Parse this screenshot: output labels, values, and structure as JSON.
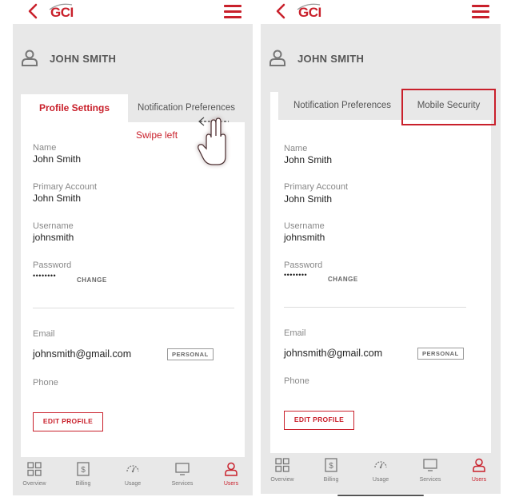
{
  "left_screen": {
    "header": {
      "logo_text": "GCI"
    },
    "user": {
      "name": "JOHN SMITH"
    },
    "tabs": [
      {
        "label": "Profile Settings",
        "active": true
      },
      {
        "label": "Notification Preferences",
        "active": false
      }
    ],
    "gesture": {
      "label": "Swipe left"
    },
    "fields": {
      "name_label": "Name",
      "name_value": "John Smith",
      "account_label": "Primary Account",
      "account_value": "John Smith",
      "username_label": "Username",
      "username_value": "johnsmith",
      "password_label": "Password",
      "password_value": "••••••••",
      "change_label": "CHANGE",
      "email_label": "Email",
      "email_value": "johnsmith@gmail.com",
      "email_badge": "PERSONAL",
      "phone_label": "Phone"
    },
    "edit_button": "EDIT PROFILE"
  },
  "right_screen": {
    "header": {
      "logo_text": "GCI"
    },
    "user": {
      "name": "JOHN SMITH"
    },
    "tabs": [
      {
        "label": "Notification Preferences",
        "active": false
      },
      {
        "label": "Mobile Security",
        "active": false
      }
    ],
    "fields": {
      "name_label": "Name",
      "name_value": "John Smith",
      "account_label": "Primary Account",
      "account_value": "John Smith",
      "username_label": "Username",
      "username_value": "johnsmith",
      "password_label": "Password",
      "password_value": "••••••••",
      "change_label": "CHANGE",
      "email_label": "Email",
      "email_value": "johnsmith@gmail.com",
      "email_badge": "PERSONAL",
      "phone_label": "Phone"
    },
    "edit_button": "EDIT PROFILE"
  },
  "bottom_nav": [
    {
      "label": "Overview",
      "icon": "grid-icon",
      "active": false
    },
    {
      "label": "Billing",
      "icon": "billing-icon",
      "active": false
    },
    {
      "label": "Usage",
      "icon": "gauge-icon",
      "active": false
    },
    {
      "label": "Services",
      "icon": "monitor-icon",
      "active": false
    },
    {
      "label": "Users",
      "icon": "user-icon",
      "active": true
    }
  ],
  "colors": {
    "brand": "#c9202b",
    "background": "#e8e8e8",
    "card": "#ffffff"
  }
}
